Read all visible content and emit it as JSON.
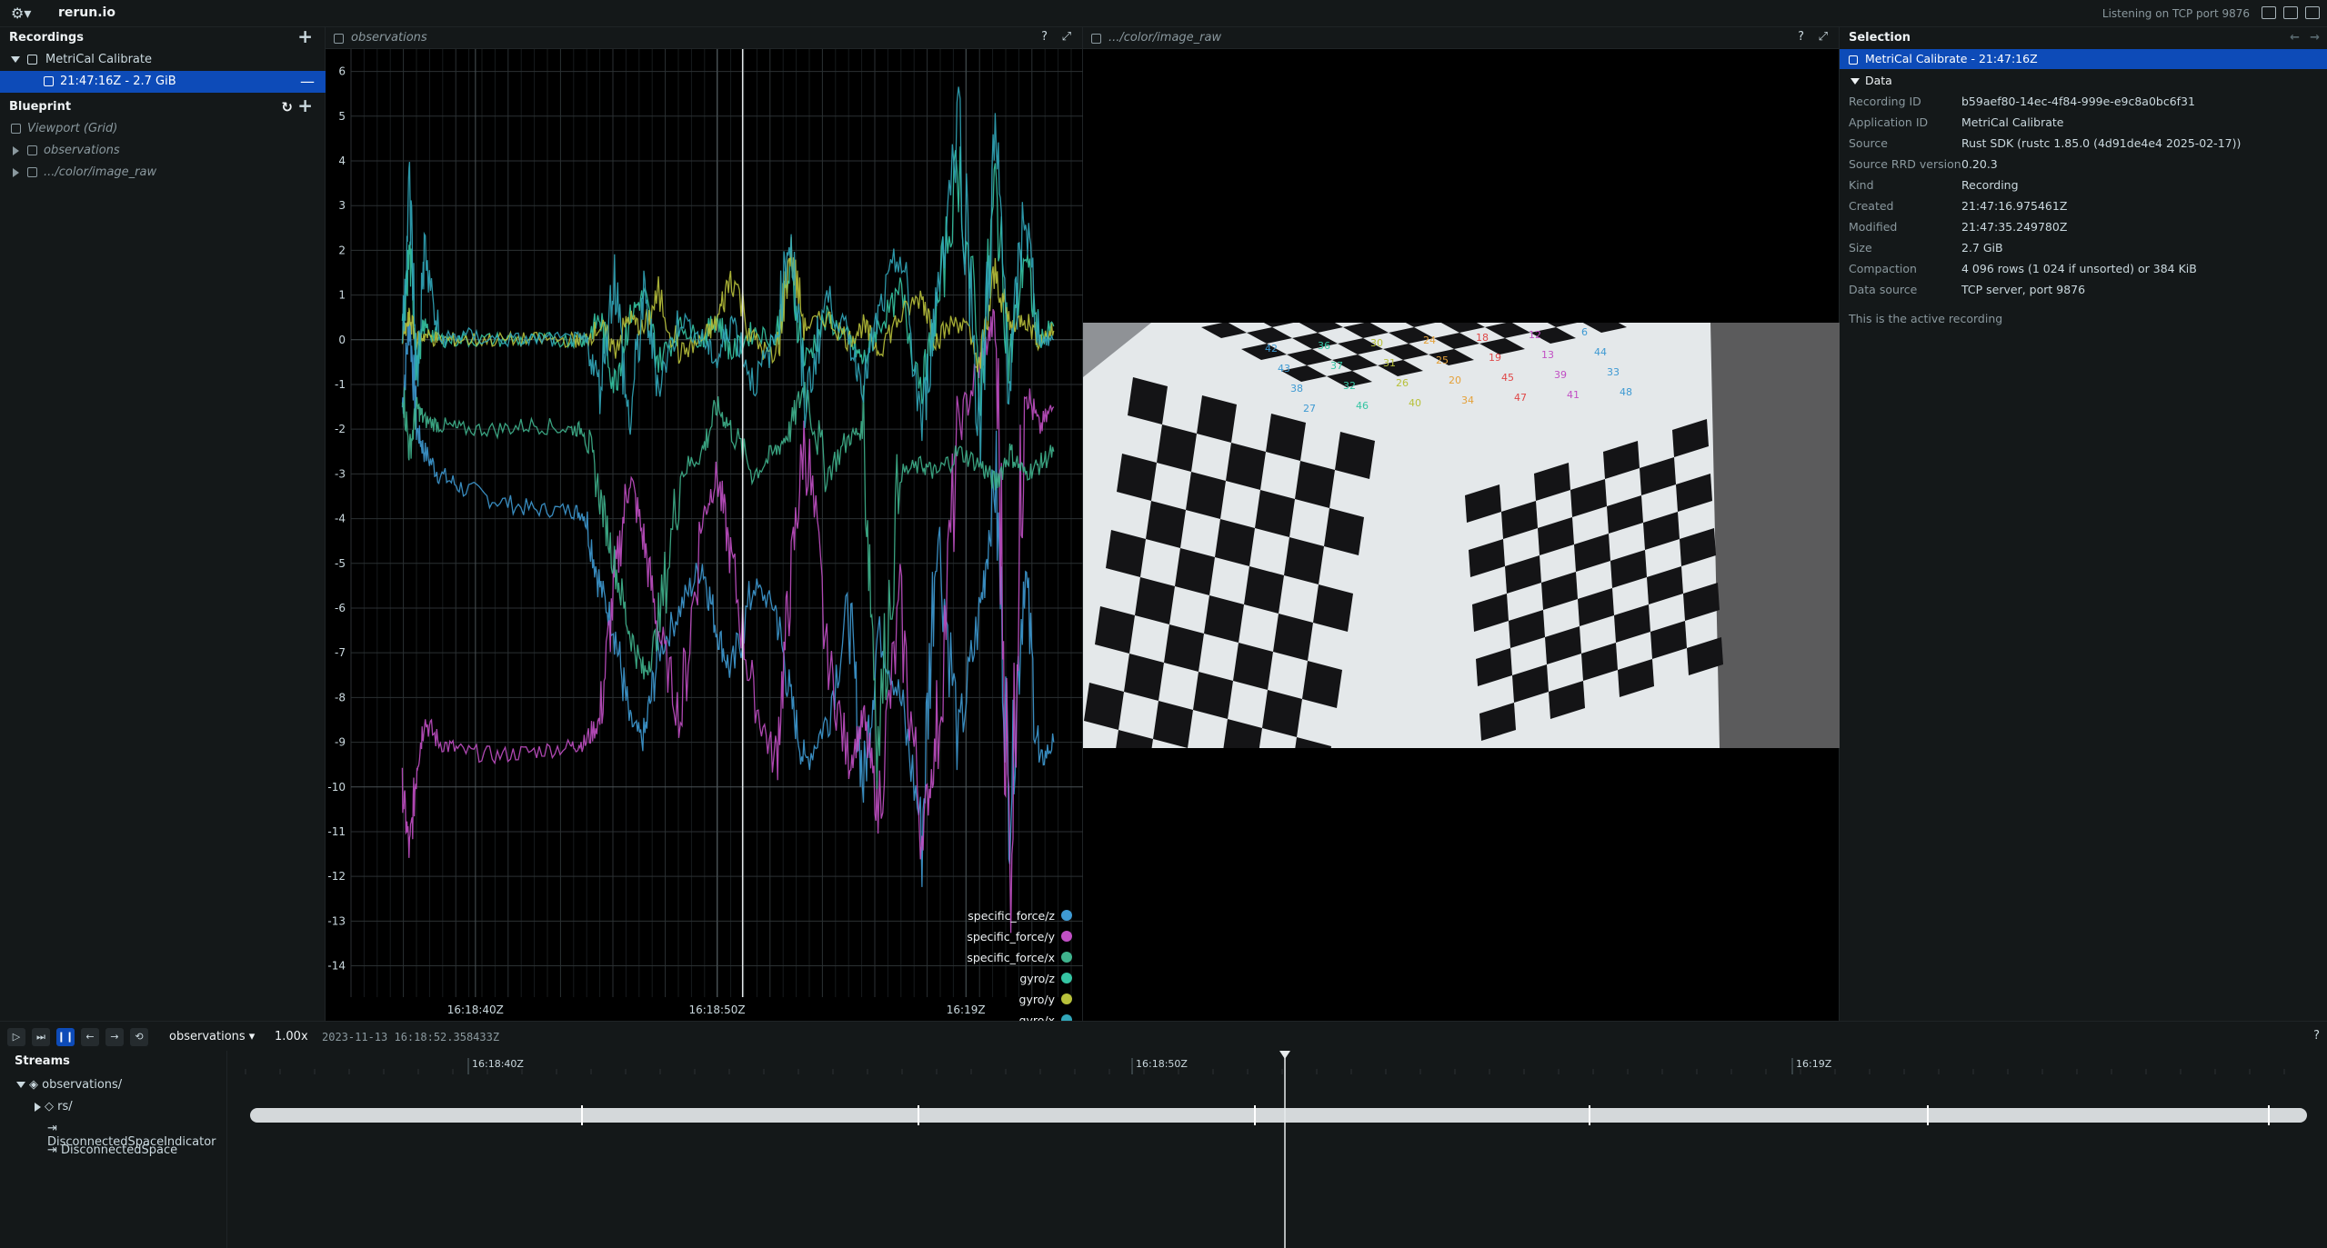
{
  "topbar": {
    "app_name": "rerun.io",
    "status": "Listening on TCP port 9876"
  },
  "recordings": {
    "header": "Recordings",
    "app": "MetriCal Calibrate",
    "recording": "21:47:16Z - 2.7 GiB"
  },
  "blueprint": {
    "header": "Blueprint",
    "items": [
      {
        "label": "Viewport (Grid)"
      },
      {
        "label": "observations"
      },
      {
        "label": ".../color/image_raw"
      }
    ]
  },
  "plot_view": {
    "title": "observations",
    "help": "?"
  },
  "image_view": {
    "title": ".../color/image_raw",
    "help": "?"
  },
  "selection": {
    "header": "Selection",
    "selected_item": "MetriCal Calibrate - 21:47:16Z",
    "data_header": "Data",
    "fields": [
      {
        "key": "Recording ID",
        "value": "b59aef80-14ec-4f84-999e-e9c8a0bc6f31"
      },
      {
        "key": "Application ID",
        "value": "MetriCal Calibrate"
      },
      {
        "key": "Source",
        "value": "Rust SDK (rustc 1.85.0 (4d91de4e4 2025-02-17))"
      },
      {
        "key": "Source RRD version",
        "value": "0.20.3"
      },
      {
        "key": "Kind",
        "value": "Recording"
      },
      {
        "key": "Created",
        "value": "21:47:16.975461Z"
      },
      {
        "key": "Modified",
        "value": "21:47:35.249780Z"
      },
      {
        "key": "Size",
        "value": "2.7 GiB"
      },
      {
        "key": "Compaction",
        "value": "4 096 rows (1 024 if unsorted) or 384 KiB"
      },
      {
        "key": "Data source",
        "value": "TCP server, port 9876"
      }
    ],
    "note": "This is the active recording"
  },
  "timeline": {
    "timeline_name": "observations",
    "speed": "1.00x",
    "current_time": "2023-11-13 16:18:52.358433Z",
    "help": "?",
    "streams_header": "Streams",
    "tree": [
      {
        "label": "observations/"
      },
      {
        "label": "rs/"
      },
      {
        "label": "DisconnectedSpaceIndicator"
      },
      {
        "label": "DisconnectedSpace"
      }
    ],
    "tick_labels": [
      "16:18:40Z",
      "16:18:50Z",
      "16:19Z"
    ]
  },
  "colors": {
    "specific_force_z": "#3e9ad3",
    "specific_force_y": "#c14fc4",
    "specific_force_x": "#3fb38d",
    "gyro_z": "#35c5a3",
    "gyro_y": "#b8c13b",
    "gyro_x": "#31a6b9",
    "accent": "#0d4bb8"
  },
  "chart_data": {
    "type": "line",
    "x_ticks": [
      "16:18:40Z",
      "16:18:50Z",
      "16:19Z"
    ],
    "ylim": [
      -14.7,
      6.5
    ],
    "y_ticks": [
      6,
      5,
      4,
      3,
      2,
      1,
      0,
      -1,
      -2,
      -3,
      -4,
      -5,
      -6,
      -7,
      -8,
      -9,
      -10,
      -11,
      -12,
      -13,
      -14
    ],
    "grid": true,
    "legend_placement": "bottom-right",
    "cursor_x": 0.535,
    "series": [
      {
        "name": "specific_force/z",
        "color": "#3e9ad3",
        "x": [
          0.07,
          0.08,
          0.09,
          0.1,
          0.12,
          0.15,
          0.2,
          0.25,
          0.3,
          0.32,
          0.34,
          0.36,
          0.38,
          0.4,
          0.42,
          0.45,
          0.48,
          0.5,
          0.52,
          0.55,
          0.58,
          0.6,
          0.62,
          0.65,
          0.68,
          0.7,
          0.72,
          0.75,
          0.78,
          0.8,
          0.83,
          0.86,
          0.88,
          0.9,
          0.92,
          0.94,
          0.96
        ],
        "values": [
          -1.5,
          0.5,
          -2.0,
          -2.5,
          -3.0,
          -3.3,
          -3.6,
          -3.8,
          -3.8,
          -3.9,
          -5.5,
          -6.5,
          -8.5,
          -9.0,
          -7.0,
          -6.0,
          -5.0,
          -6.5,
          -7.5,
          -5.5,
          -6.0,
          -8.0,
          -9.5,
          -8.5,
          -6.0,
          -10.0,
          -6.5,
          -8.0,
          -11.0,
          -4.0,
          -9.0,
          -6.0,
          -3.0,
          -10.5,
          -5.0,
          -9.5,
          -9.0
        ]
      },
      {
        "name": "specific_force/y",
        "color": "#c14fc4",
        "x": [
          0.07,
          0.08,
          0.09,
          0.1,
          0.12,
          0.15,
          0.2,
          0.25,
          0.3,
          0.32,
          0.34,
          0.36,
          0.38,
          0.4,
          0.42,
          0.45,
          0.48,
          0.5,
          0.52,
          0.55,
          0.58,
          0.6,
          0.62,
          0.65,
          0.68,
          0.7,
          0.72,
          0.75,
          0.78,
          0.8,
          0.83,
          0.86,
          0.88,
          0.9,
          0.92,
          0.94,
          0.96
        ],
        "values": [
          -10.0,
          -11.5,
          -9.5,
          -8.5,
          -9.0,
          -9.2,
          -9.3,
          -9.2,
          -9.1,
          -9.0,
          -8.5,
          -5.5,
          -3.0,
          -4.5,
          -6.5,
          -8.5,
          -4.0,
          -3.0,
          -5.0,
          -8.0,
          -9.5,
          -5.5,
          -2.0,
          -7.0,
          -9.5,
          -8.5,
          -10.5,
          -6.0,
          -11.0,
          -9.0,
          -2.0,
          -0.5,
          0.5,
          -12.0,
          -1.0,
          -2.0,
          -1.5
        ]
      },
      {
        "name": "specific_force/x",
        "color": "#3fb38d",
        "x": [
          0.07,
          0.08,
          0.09,
          0.1,
          0.12,
          0.15,
          0.2,
          0.25,
          0.3,
          0.32,
          0.34,
          0.36,
          0.38,
          0.4,
          0.42,
          0.45,
          0.48,
          0.5,
          0.52,
          0.55,
          0.58,
          0.6,
          0.62,
          0.65,
          0.68,
          0.7,
          0.72,
          0.75,
          0.78,
          0.8,
          0.83,
          0.86,
          0.88,
          0.9,
          0.92,
          0.94,
          0.96
        ],
        "values": [
          -1.0,
          -2.5,
          -1.5,
          -1.8,
          -1.9,
          -2.0,
          -2.0,
          -1.9,
          -2.0,
          -2.0,
          -3.5,
          -5.0,
          -6.5,
          -7.5,
          -6.5,
          -3.0,
          -2.5,
          -1.5,
          -2.0,
          -3.0,
          -2.5,
          -2.0,
          -1.0,
          -3.0,
          -2.2,
          -2.0,
          -9.0,
          -3.0,
          -2.8,
          -3.0,
          -2.5,
          -2.8,
          -3.2,
          -2.5,
          -3.0,
          -2.8,
          -2.5
        ]
      },
      {
        "name": "gyro/z",
        "color": "#35c5a3",
        "x": [
          0.07,
          0.08,
          0.09,
          0.1,
          0.12,
          0.15,
          0.2,
          0.25,
          0.3,
          0.32,
          0.34,
          0.36,
          0.38,
          0.4,
          0.42,
          0.45,
          0.48,
          0.5,
          0.52,
          0.55,
          0.58,
          0.6,
          0.62,
          0.65,
          0.68,
          0.7,
          0.72,
          0.75,
          0.78,
          0.8,
          0.83,
          0.86,
          0.88,
          0.9,
          0.92,
          0.94,
          0.96
        ],
        "values": [
          0.0,
          2.0,
          -0.5,
          0.3,
          0.0,
          0.0,
          0.0,
          0.0,
          0.0,
          0.0,
          0.5,
          -1.0,
          0.5,
          1.0,
          -0.5,
          0.3,
          0.0,
          0.5,
          -0.3,
          0.2,
          0.0,
          1.5,
          -0.5,
          0.5,
          0.0,
          -0.5,
          0.3,
          1.0,
          -1.0,
          0.5,
          4.0,
          -1.0,
          3.5,
          -0.5,
          2.0,
          0.0,
          0.3
        ]
      },
      {
        "name": "gyro/y",
        "color": "#b8c13b",
        "x": [
          0.07,
          0.08,
          0.09,
          0.1,
          0.12,
          0.15,
          0.2,
          0.25,
          0.3,
          0.32,
          0.34,
          0.36,
          0.38,
          0.4,
          0.42,
          0.45,
          0.48,
          0.5,
          0.52,
          0.55,
          0.58,
          0.6,
          0.62,
          0.65,
          0.68,
          0.7,
          0.72,
          0.75,
          0.78,
          0.8,
          0.83,
          0.86,
          0.88,
          0.9,
          0.92,
          0.94,
          0.96
        ],
        "values": [
          0.0,
          0.5,
          0.0,
          0.1,
          0.0,
          0.0,
          0.0,
          0.0,
          0.0,
          0.0,
          0.3,
          -0.2,
          0.5,
          0.2,
          1.0,
          -0.3,
          0.0,
          0.4,
          1.5,
          0.0,
          -0.5,
          2.0,
          0.3,
          0.5,
          0.0,
          0.3,
          -0.2,
          0.5,
          1.0,
          0.0,
          0.5,
          -0.5,
          1.5,
          0.3,
          0.5,
          0.0,
          0.2
        ]
      },
      {
        "name": "gyro/x",
        "color": "#31a6b9",
        "x": [
          0.07,
          0.08,
          0.09,
          0.1,
          0.12,
          0.15,
          0.2,
          0.25,
          0.3,
          0.32,
          0.34,
          0.36,
          0.38,
          0.4,
          0.42,
          0.45,
          0.48,
          0.5,
          0.52,
          0.55,
          0.58,
          0.6,
          0.62,
          0.65,
          0.68,
          0.7,
          0.72,
          0.75,
          0.78,
          0.8,
          0.83,
          0.86,
          0.88,
          0.9,
          0.92,
          0.94,
          0.96
        ],
        "values": [
          0.0,
          3.5,
          -1.0,
          2.0,
          0.0,
          0.1,
          0.0,
          0.0,
          0.0,
          0.0,
          -1.0,
          1.5,
          -2.0,
          1.0,
          -1.0,
          0.5,
          0.0,
          -0.5,
          0.5,
          -1.0,
          0.0,
          2.5,
          -1.5,
          1.0,
          0.0,
          -1.0,
          0.5,
          2.0,
          -2.0,
          1.0,
          5.0,
          -2.0,
          4.5,
          -1.0,
          3.0,
          0.0,
          0.0
        ]
      }
    ]
  }
}
